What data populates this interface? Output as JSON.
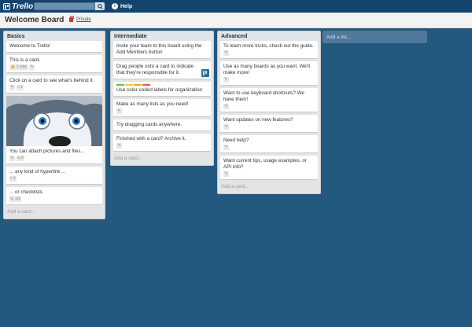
{
  "header": {
    "logo_text": "Trello",
    "search_placeholder": "",
    "help_label": "Help"
  },
  "board": {
    "title": "Welcome Board",
    "privacy_label": "Private"
  },
  "lists": [
    {
      "title": "Basics",
      "cards": [
        {
          "text": "Welcome to Trello!",
          "badges": []
        },
        {
          "text": "This is a card.",
          "badges": [
            "1 vote",
            "edit"
          ]
        },
        {
          "text": "Click on a card to see what's behind it.",
          "badges": [
            "edit",
            "1"
          ]
        },
        {
          "text": "You can attach pictures and files...",
          "badges": [
            "edit",
            "2"
          ],
          "cover": "husky"
        },
        {
          "text": "... any kind of hyperlink ...",
          "badges": [
            "1"
          ]
        },
        {
          "text": "... or checklists.",
          "badges": [
            "1/3"
          ]
        }
      ],
      "add_card_label": "Add a card..."
    },
    {
      "title": "Intermediate",
      "cards": [
        {
          "text": "Invite your team to this board using the Add Members button",
          "badges": []
        },
        {
          "text": "Drag people onto a card to indicate that they're responsible for it.",
          "badges": [],
          "member": true
        },
        {
          "text": "Use color-coded labels for organization",
          "badges": [],
          "labels": [
            "#61bd4f",
            "#f2d600",
            "#ff9f1a",
            "#eb5a46"
          ]
        },
        {
          "text": "Make as many lists as you need!",
          "badges": [
            "edit"
          ]
        },
        {
          "text": "Try dragging cards anywhere.",
          "badges": []
        },
        {
          "text": "Finished with a card? Archive it.",
          "badges": [
            "edit"
          ]
        }
      ],
      "add_card_label": "Add a card..."
    },
    {
      "title": "Advanced",
      "cards": [
        {
          "text": "To learn more tricks, check out the guide.",
          "badges": [
            "edit"
          ]
        },
        {
          "text": "Use as many boards as you want. We'll make more!",
          "badges": [
            "edit"
          ]
        },
        {
          "text": "Want to use keyboard shortcuts? We have them!",
          "badges": [
            "edit"
          ]
        },
        {
          "text": "Want updates on new features?",
          "badges": [
            "edit"
          ]
        },
        {
          "text": "Need help?",
          "badges": [
            "edit"
          ]
        },
        {
          "text": "Want current tips, usage examples, or API info?",
          "badges": [
            "edit"
          ]
        }
      ],
      "add_card_label": "Add a card..."
    }
  ],
  "add_list_label": "Add a list...",
  "colors": {
    "background": "#23587f",
    "header": "#14446c",
    "list": "#e2e4e6",
    "card": "#ffffff"
  },
  "icons": {
    "search": "search-icon",
    "help": "help-icon",
    "edit": "pencil-icon",
    "privacy": "lock-icon",
    "vote": "thumbs-up-icon",
    "comment": "comment-icon",
    "checklist": "checklist-icon",
    "attachment": "paperclip-icon"
  }
}
